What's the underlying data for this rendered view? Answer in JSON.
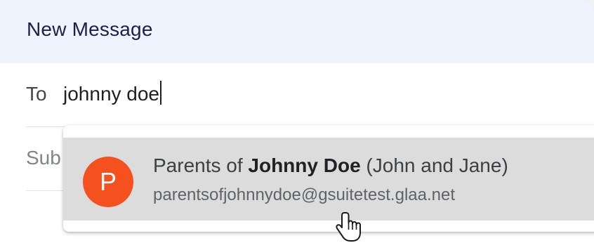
{
  "compose": {
    "title": "New Message",
    "to_label": "To",
    "to_value": "johnny doe",
    "subject_label": "Sub"
  },
  "autocomplete": {
    "items": [
      {
        "avatar_letter": "P",
        "name_prefix": "Parents of ",
        "name_bold": "Johnny Doe",
        "name_suffix": " (John and Jane)",
        "email": "parentsofjohnnydoe@gsuitetest.glaa.net",
        "avatar_color": "#f4511e"
      }
    ]
  },
  "cursor": {
    "icon": "hand-pointer-icon"
  }
}
